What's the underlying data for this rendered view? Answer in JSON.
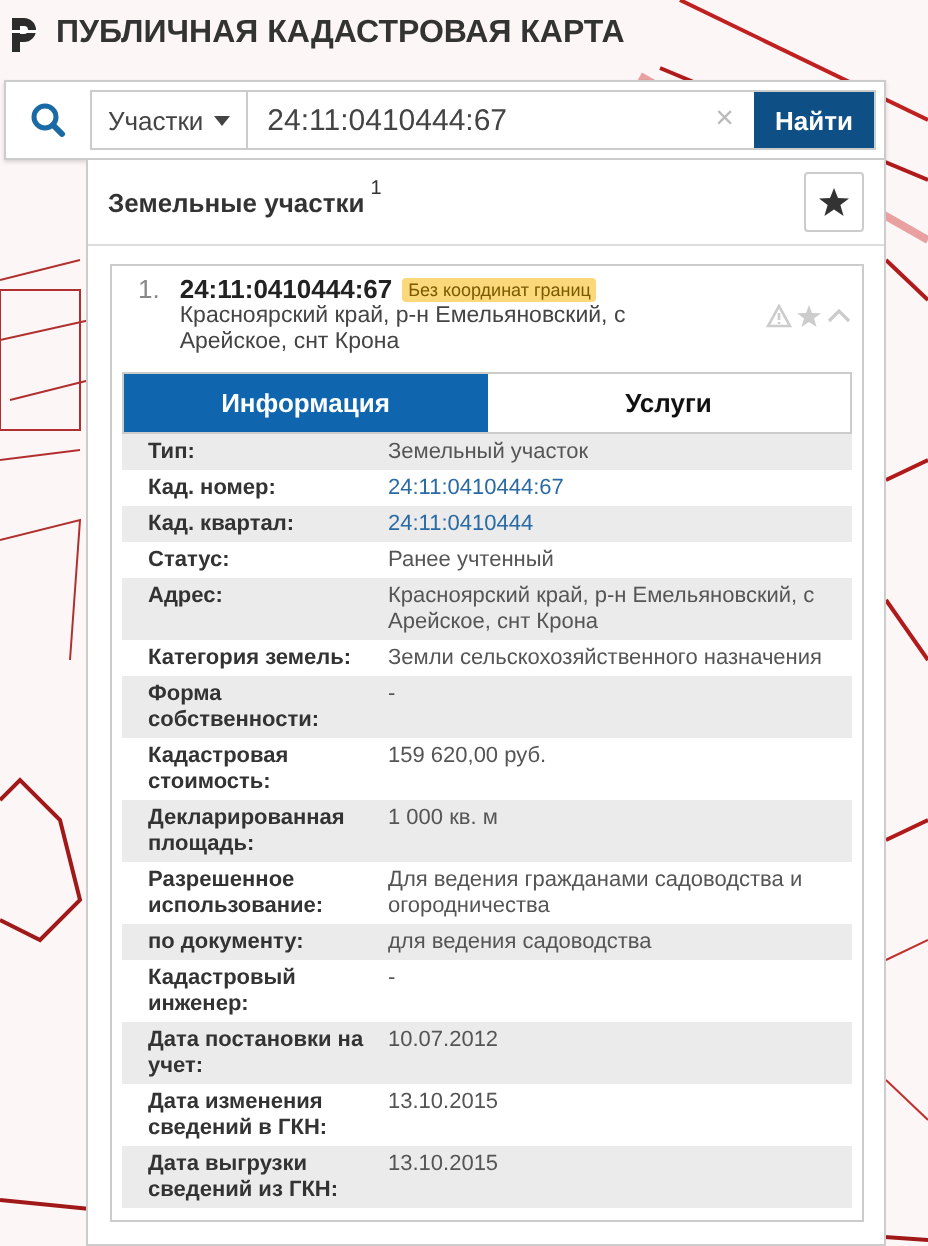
{
  "header": {
    "title": "ПУБЛИЧНАЯ КАДАСТРОВАЯ КАРТА"
  },
  "search": {
    "category": "Участки",
    "value": "24:11:0410444:67",
    "clear": "×",
    "button": "Найти"
  },
  "panel": {
    "title": "Земельные участки",
    "count": "1"
  },
  "result": {
    "index": "1.",
    "number": "24:11:0410444:67",
    "badge": "Без координат границ",
    "address": "Красноярский край, р-н Емельяновский, с Арейское, снт Крона",
    "tabs": [
      {
        "label": "Информация",
        "selected": true
      },
      {
        "label": "Услуги",
        "selected": false
      }
    ],
    "rows": [
      {
        "label": "Тип:",
        "value": "Земельный участок",
        "kind": "text"
      },
      {
        "label": "Кад. номер:",
        "value": "24:11:0410444:67",
        "kind": "link"
      },
      {
        "label": "Кад. квартал:",
        "value": "24:11:0410444",
        "kind": "link"
      },
      {
        "label": "Статус:",
        "value": "Ранее учтенный",
        "kind": "text"
      },
      {
        "label": "Адрес:",
        "value": "Красноярский край, р-н Емельяновский, с Арейское, снт Крона",
        "kind": "text"
      },
      {
        "label": "Категория земель:",
        "value": "Земли сельскохозяйственного назначения",
        "kind": "text"
      },
      {
        "label": "Форма собственности:",
        "value": "-",
        "kind": "text"
      },
      {
        "label": "Кадастровая стоимость:",
        "value": "159 620,00 руб.",
        "kind": "text"
      },
      {
        "label": "Декларированная площадь:",
        "value": "1 000 кв. м",
        "kind": "text"
      },
      {
        "label": "Разрешенное использование:",
        "value": "Для ведения гражданами садоводства и огородничества",
        "kind": "text"
      },
      {
        "label": "по документу:",
        "value": "для ведения садоводства",
        "kind": "text"
      },
      {
        "label": "Кадастровый инженер:",
        "value": "-",
        "kind": "text"
      },
      {
        "label": "Дата постановки на учет:",
        "value": "10.07.2012",
        "kind": "text"
      },
      {
        "label": "Дата изменения сведений в ГКН:",
        "value": "13.10.2015",
        "kind": "text"
      },
      {
        "label": "Дата выгрузки сведений из ГКН:",
        "value": "13.10.2015",
        "kind": "text"
      }
    ]
  }
}
